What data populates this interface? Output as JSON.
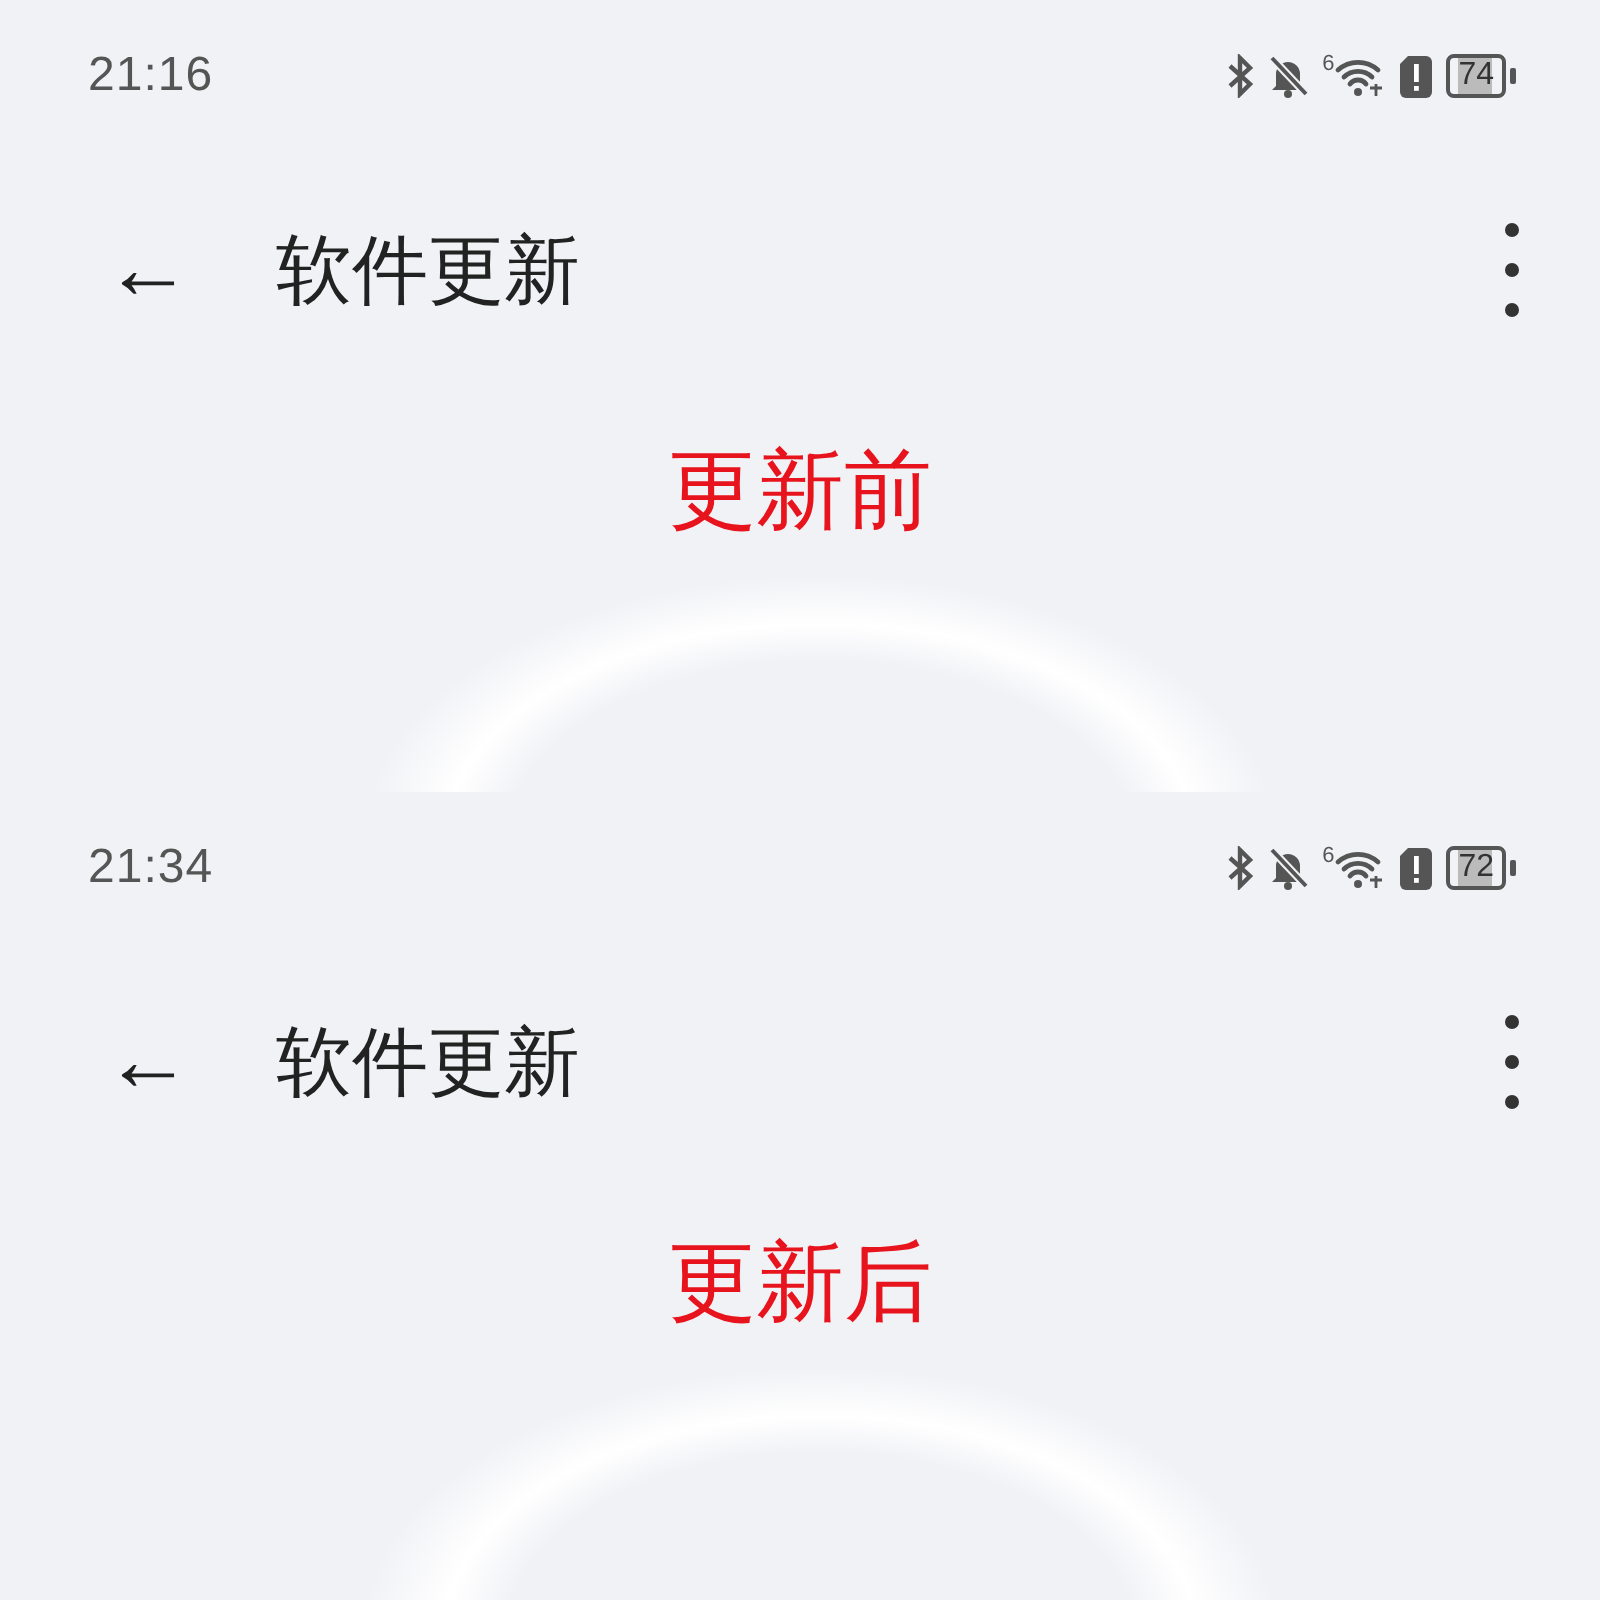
{
  "panels": [
    {
      "status_bar": {
        "time": "21:16",
        "wifi_badge": "6",
        "battery": "74"
      },
      "header": {
        "back": "←",
        "title": "软件更新"
      },
      "caption": "更新前"
    },
    {
      "status_bar": {
        "time": "21:34",
        "wifi_badge": "6",
        "battery": "72"
      },
      "header": {
        "back": "←",
        "title": "软件更新"
      },
      "caption": "更新后"
    }
  ]
}
